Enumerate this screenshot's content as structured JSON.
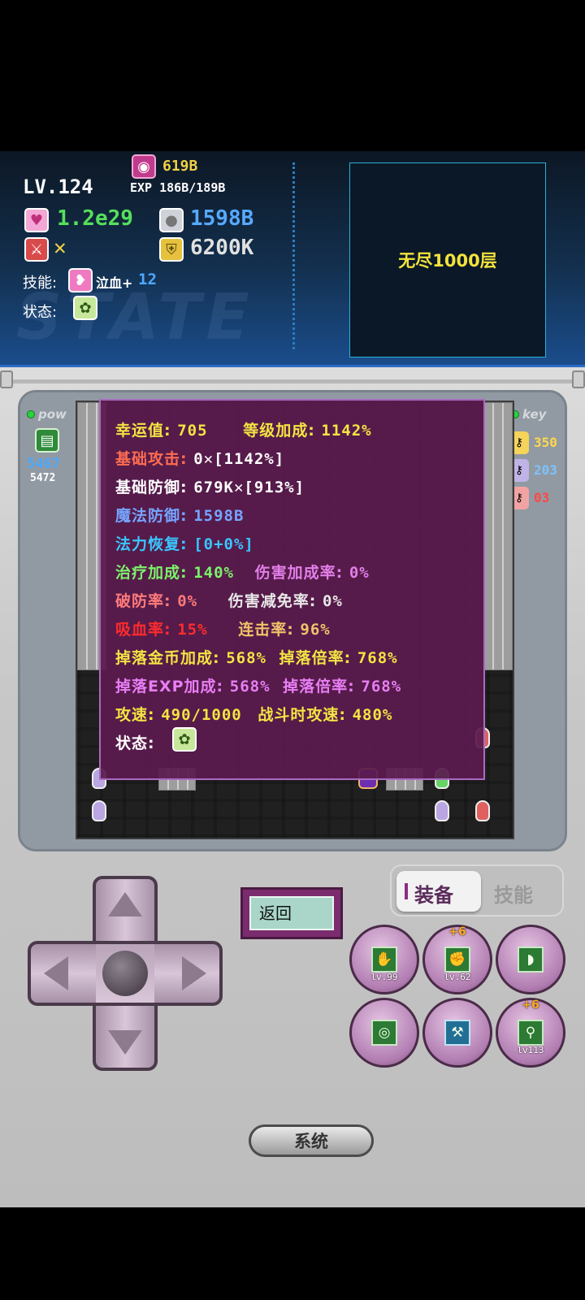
{
  "hud": {
    "level": "LV.124",
    "exp_label": "EXP 186B/189B",
    "gold": "619B",
    "hp": "1.2e29",
    "defense_orb": "1598B",
    "attack": "✕",
    "shield": "6200K",
    "skill_label": "技能:",
    "skill_name": "泣血+",
    "skill_level": "12",
    "status_label": "状态:",
    "watermark": "STATE",
    "floor": "无尽1000层"
  },
  "left_panel": {
    "pow": "pow",
    "value1": "5467",
    "value2": "5472"
  },
  "right_panel": {
    "key": "key",
    "keys": [
      {
        "count": "350",
        "color": "#ffd84a"
      },
      {
        "count": "203",
        "color": "#7ec2ff"
      },
      {
        "count": "03",
        "color": "#ff4848"
      }
    ]
  },
  "stats": [
    {
      "label": "幸运值:",
      "value": "705",
      "label2": "等级加成:",
      "value2": "1142%",
      "color": "#f4e443"
    },
    {
      "label": "基础攻击:",
      "value": "0✕[1142%]",
      "color": "#ff6d51"
    },
    {
      "label": "基础防御:",
      "value": "679K✕[913%]",
      "color": "#ffffff"
    },
    {
      "label": "魔法防御:",
      "value": "1598B",
      "color": "#76a4ff"
    },
    {
      "label": "法力恢复:",
      "value": "[0+0%]",
      "color": "#39c6ff"
    },
    {
      "label": "治疗加成:",
      "value": "140%",
      "label2": "伤害加成率:",
      "value2": "0%",
      "color": "#7cf26a",
      "color2": "#e17fe8"
    },
    {
      "label": "破防率:",
      "value": "0%",
      "label2": "伤害减免率:",
      "value2": "0%",
      "color": "#ff7b7b",
      "color2": "#e8e8e8"
    },
    {
      "label": "吸血率:",
      "value": "15%",
      "label2": "连击率:",
      "value2": "96%",
      "color": "#ff2c2c",
      "color2": "#f1c36a"
    },
    {
      "label": "掉落金币加成:",
      "value": "568%",
      "label2": "掉落倍率:",
      "value2": "768%",
      "color": "#f4e443",
      "color2": "#f4e443"
    },
    {
      "label": "掉落EXP加成:",
      "value": "568%",
      "label2": "掉落倍率:",
      "value2": "768%",
      "color": "#e87ef5",
      "color2": "#e87ef5"
    },
    {
      "label": "攻速:",
      "value": "490/1000",
      "label2": "战斗时攻速:",
      "value2": "480%",
      "color": "#f4e443",
      "color2": "#f4e443"
    },
    {
      "label": "状态:",
      "value": "",
      "color": "#ffffff"
    }
  ],
  "controls": {
    "back": "返回",
    "tab_equip": "装备",
    "tab_skill": "技能",
    "system": "系统",
    "slots": [
      {
        "icon": "boot-icon",
        "glyph": "✋",
        "lv": "lv.99",
        "plus": ""
      },
      {
        "icon": "gloves-icon",
        "glyph": "✊",
        "lv": "lv.62",
        "plus": "+6"
      },
      {
        "icon": "bow-icon",
        "glyph": "◗",
        "lv": "",
        "plus": ""
      },
      {
        "icon": "ring-icon",
        "glyph": "◎",
        "lv": "",
        "plus": ""
      },
      {
        "icon": "hammer-icon",
        "glyph": "⚒",
        "lv": "",
        "plus": ""
      },
      {
        "icon": "staff-icon",
        "glyph": "⚲",
        "lv": "lv113",
        "plus": "+6"
      }
    ]
  },
  "colors": {
    "floor_text": "#f3e33b",
    "hp": "#55e05a",
    "orb": "#57a9ff",
    "shield": "#e0e0e0",
    "gold": "#f0d046"
  }
}
